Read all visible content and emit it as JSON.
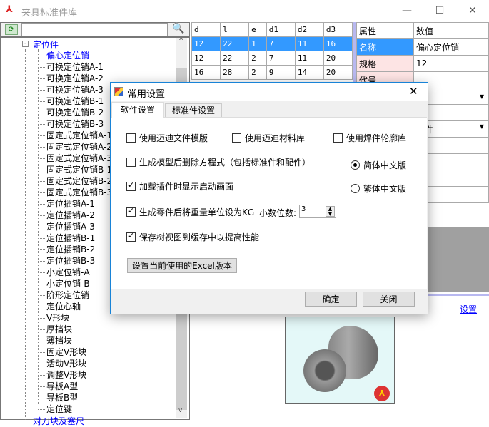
{
  "window": {
    "title": "夹具标准件库",
    "minimize": "—",
    "maximize": "☐",
    "close": "✕"
  },
  "tree": {
    "root": "定位件",
    "items": [
      "偏心定位销",
      "可换定位销A-1",
      "可换定位销A-2",
      "可换定位销A-3",
      "可换定位销B-1",
      "可换定位销B-2",
      "可换定位销B-3",
      "固定式定位销A-1",
      "固定式定位销A-2",
      "固定式定位销A-3",
      "固定式定位销B-1",
      "固定式定位销B-2",
      "固定式定位销B-3",
      "定位插销A-1",
      "定位插销A-2",
      "定位插销A-3",
      "定位插销B-1",
      "定位插销B-2",
      "定位插销B-3",
      "小定位销-A",
      "小定位销-B",
      "阶形定位销",
      "定位心轴",
      "V形块",
      "厚挡块",
      "薄挡块",
      "固定V形块",
      "活动V形块",
      "调整V形块",
      "导板A型",
      "导板B型",
      "定位键"
    ],
    "next_root": "对刀块及塞尺"
  },
  "grid": {
    "headers": [
      "d",
      "l",
      "e",
      "d1",
      "d2",
      "d3"
    ],
    "rows": [
      [
        "12",
        "22",
        "1",
        "7",
        "11",
        "16"
      ],
      [
        "12",
        "22",
        "2",
        "7",
        "11",
        "20"
      ],
      [
        "16",
        "28",
        "2",
        "9",
        "14",
        "20"
      ]
    ]
  },
  "props": {
    "headers": [
      "属性",
      "数值"
    ],
    "rows": [
      [
        "名称",
        "偏心定位销"
      ],
      [
        "规格",
        "12"
      ],
      [
        "代号",
        ""
      ]
    ],
    "partial_value": "准件"
  },
  "bottom": {
    "settings_link": "设置"
  },
  "dialog": {
    "title": "常用设置",
    "close": "✕",
    "tabs": [
      "软件设置",
      "标准件设置"
    ],
    "options": {
      "use_template": "使用迈迪文件模版",
      "use_material": "使用迈迪材料库",
      "use_weld": "使用焊件轮廓库",
      "delete_equations": "生成模型后删除方程式（包括标准件和配件）",
      "show_splash": "加载插件时显示启动画面",
      "set_kg": "生成零件后将重量单位设为KG",
      "decimals_label": "小数位数:",
      "decimals_value": "3",
      "save_tree": "保存树视图到缓存中以提高性能"
    },
    "checked": {
      "use_template": false,
      "use_material": false,
      "use_weld": false,
      "delete_equations": false,
      "show_splash": true,
      "set_kg": true,
      "save_tree": true
    },
    "radios": [
      "简体中文版",
      "繁体中文版"
    ],
    "radio_selected": 0,
    "excel_button": "设置当前使用的Excel版本",
    "ok": "确定",
    "cancel": "关闭"
  }
}
